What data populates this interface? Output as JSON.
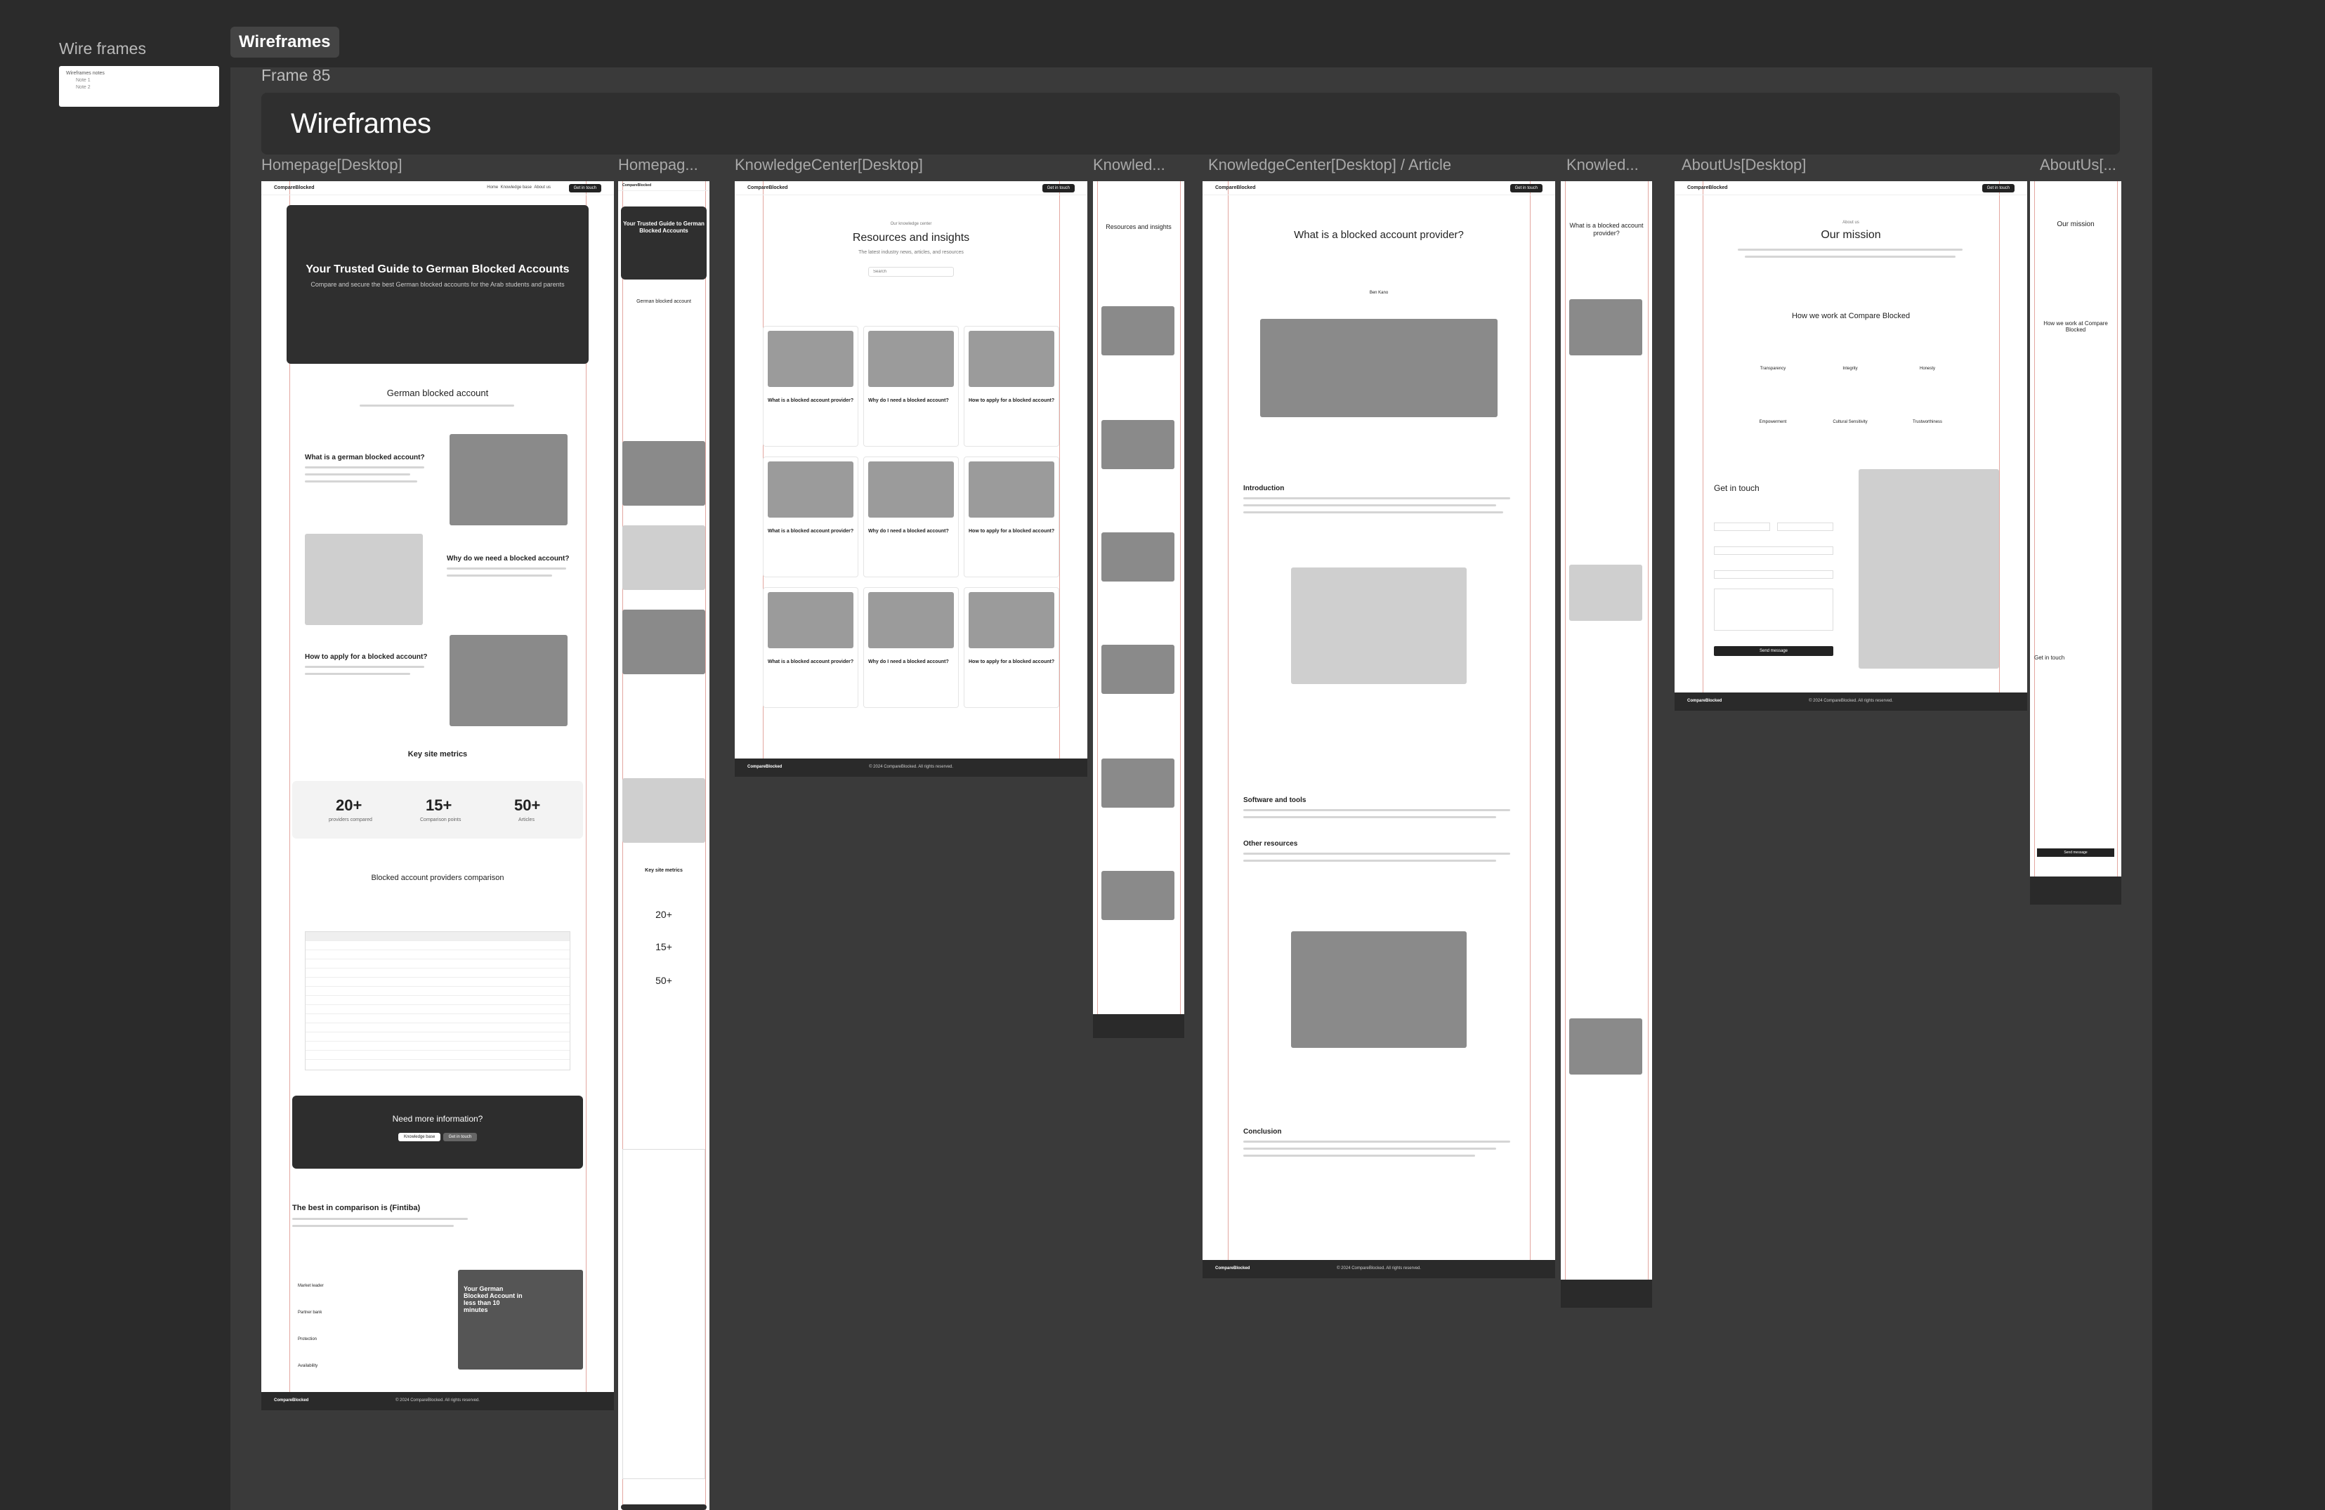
{
  "app": {
    "pages_panel_title": "Wire frames",
    "pages_list": [
      "Wireframes notes",
      "Note 1",
      "Note 2"
    ],
    "frame_tag": "Wireframes",
    "frame_name": "Frame 85",
    "header_title": "Wireframes"
  },
  "frames": {
    "homepage_desktop": "Homepage[Desktop]",
    "homepage_mobile": "Homepag...",
    "kc_desktop": "KnowledgeCenter[Desktop]",
    "kc_mobile": "Knowled...",
    "kc_article_desktop": "KnowledgeCenter[Desktop] / Article",
    "kc_article_mobile": "Knowled...",
    "about_desktop": "AboutUs[Desktop]",
    "about_mobile": "AboutUs[..."
  },
  "site": {
    "logo": "CompareBlocked",
    "nav": [
      "Home",
      "Knowledge base",
      "About us"
    ],
    "cta": "Get in touch",
    "footer_copy": "© 2024 CompareBlocked. All rights reserved."
  },
  "homepage": {
    "hero_title": "Your Trusted Guide to German Blocked Accounts",
    "hero_subtitle": "Compare and secure the best German blocked accounts for the Arab students and parents",
    "section_title": "German blocked account",
    "q1": "What is a german blocked account?",
    "q2": "Why do we need a blocked account?",
    "q3": "How to apply for a blocked account?",
    "metrics_title": "Key site metrics",
    "metrics": [
      {
        "value": "20+",
        "label": "providers compared"
      },
      {
        "value": "15+",
        "label": "Comparison points"
      },
      {
        "value": "50+",
        "label": "Articles"
      }
    ],
    "comparison_title": "Blocked account providers comparison",
    "cta_title": "Need more information?",
    "cta_buttons": [
      "Knowledge base",
      "Get in touch"
    ],
    "best_title": "The best in comparison is (Fintiba)",
    "promo_title": "Your German Blocked Account in less than 10 minutes",
    "features": [
      "Market leader",
      "Partner bank",
      "Protection",
      "Availability"
    ]
  },
  "knowledge": {
    "eyebrow": "Our knowledge center",
    "title": "Resources and insights",
    "subtitle": "The latest industry news, articles, and resources",
    "search_placeholder": "Search",
    "card_titles": [
      "What is a blocked account provider?",
      "Why do I need a blocked account?",
      "How to apply for a blocked account?",
      "What is a blocked account provider?",
      "Why do I need a blocked account?",
      "How to apply for a blocked account?",
      "What is a blocked account provider?",
      "Why do I need a blocked account?",
      "How to apply for a blocked account?"
    ]
  },
  "article": {
    "title": "What is a blocked account provider?",
    "author": "Ben Kano",
    "sections": [
      "Introduction",
      "Software and tools",
      "Other resources",
      "Conclusion"
    ]
  },
  "about": {
    "eyebrow": "About us",
    "title": "Our mission",
    "how_title": "How we work at Compare Blocked",
    "values": [
      "Transparency",
      "Integrity",
      "Honesty",
      "Empowerment",
      "Cultural Sensitivity",
      "Trustworthiness"
    ],
    "contact_title": "Get in touch",
    "send_button": "Send message"
  }
}
